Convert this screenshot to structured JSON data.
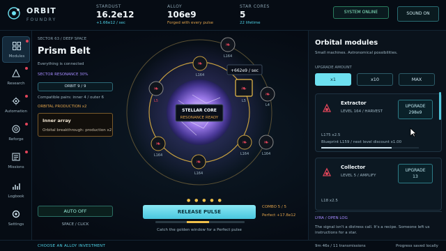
{
  "brand": {
    "name": "ORBIT",
    "sub": "FOUNDRY"
  },
  "stats": [
    {
      "label": "STARDUST",
      "value": "16.2e12",
      "sub": "+1.66e12 / sec",
      "sub_color": "#4fd4e8"
    },
    {
      "label": "ALLOY",
      "value": "106e9",
      "sub": "Forged with every pulse",
      "sub_color": "#e0a24a"
    },
    {
      "label": "STAR CORES",
      "value": "5",
      "sub": "22 lifetime",
      "sub_color": "#4fd4e8"
    }
  ],
  "topbar": {
    "system_status": "SYSTEM ONLINE",
    "sound": "SOUND ON"
  },
  "nav": [
    {
      "label": "Modules",
      "icon": "grid-icon",
      "active": true,
      "alert": true
    },
    {
      "label": "Research",
      "icon": "triangle-icon",
      "active": false,
      "alert": true
    },
    {
      "label": "Automation",
      "icon": "gear-icon",
      "active": false,
      "alert": true
    },
    {
      "label": "Reforge",
      "icon": "reforge-icon",
      "active": false,
      "alert": true
    },
    {
      "label": "Missions",
      "icon": "missions-icon",
      "active": false,
      "alert": true
    },
    {
      "label": "Logbook",
      "icon": "chart-icon",
      "active": false,
      "alert": false
    },
    {
      "label": "Settings",
      "icon": "settings-icon",
      "active": false,
      "alert": false
    }
  ],
  "sector": {
    "breadcrumb": "SECTOR 63 / DEEP SPACE",
    "name": "Prism Belt",
    "status": "Everything is connected",
    "resonance": "SECTOR RESONANCE 30%",
    "orbit": "ORBIT 9 / 9",
    "compat": "Compatible pairs: inner 4 / outer 6",
    "production": "ORBITAL PRODUCTION x2",
    "inner_title": "Inner array",
    "inner_text": "Orbital breakthrough: production x2"
  },
  "core": {
    "title": "STELLAR CORE",
    "status": "RESONANCE READY",
    "rate_popup": "+662e9 / sec"
  },
  "orbit_nodes": [
    {
      "label": "L164",
      "kind": "harvest"
    },
    {
      "label": "L164",
      "kind": "harvest"
    },
    {
      "label": "L5",
      "kind": "amp"
    },
    {
      "label": "L5",
      "kind": "amp"
    },
    {
      "label": "L4",
      "kind": "harvest"
    },
    {
      "label": "L164",
      "kind": "harvest"
    },
    {
      "label": "L164",
      "kind": "harvest"
    },
    {
      "label": "L164",
      "kind": "harvest"
    },
    {
      "label": "L164",
      "kind": "harvest"
    }
  ],
  "controls": {
    "auto": "AUTO OFF",
    "shortcut": "SPACE / CLICK",
    "release": "RELEASE PULSE",
    "hint": "Catch the golden window for a Perfect pulse",
    "combo": "COMBO 5 / 5",
    "perfect": "Perfect +17.8e12",
    "charges": "● ● ● ● ●"
  },
  "panel": {
    "title": "Orbital modules",
    "subtitle": "Small machines. Astronomical possibilities.",
    "amount_label": "UPGRADE AMOUNT",
    "amounts": [
      "x1",
      "x10",
      "MAX"
    ],
    "active_amount": 0,
    "modules": [
      {
        "name": "Extractor",
        "level": "LEVEL 164 / HARVEST",
        "upgrade": "UPGRADE",
        "cost": "298e9",
        "detail1": "L175 x2.5",
        "detail2": "Blueprint L159 / next level discount x1.00",
        "progress": 0.72
      },
      {
        "name": "Collector",
        "level": "LEVEL 5 / AMPLIFY",
        "upgrade": "UPGRADE",
        "cost": "13",
        "detail1": "L18 x2.5",
        "detail2": "",
        "progress": 0
      }
    ],
    "log_title": "LYRA / OPEN LOG",
    "log_text": "The signal isn't a distress call. It's a recipe. Someone left us instructions for a star."
  },
  "footer": {
    "invest": "CHOOSE AN ALLOY INVESTMENT",
    "time": "9m 46s / 11 transmissions",
    "saved": "Progress saved locally"
  },
  "colors": {
    "accent": "#6de0f0",
    "gold": "#e0a24a",
    "violet": "#a58bff",
    "alert": "#e0455a"
  }
}
